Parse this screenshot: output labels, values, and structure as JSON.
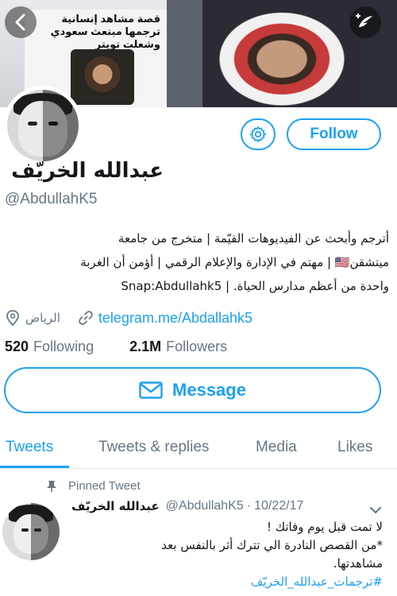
{
  "banner": {
    "headline": "قصة مشاهد إنسانية ترجمها مبتعث سعودي وشعلت تويتر"
  },
  "profile": {
    "name": "عبدالله الخريّف",
    "handle": "@AbdullahK5",
    "follow_label": "Follow",
    "bio_lines": [
      "أترجم وأبحث عن الفيديوهات القيّمة | متخرج من جامعة",
      "ميتشقن🇺🇸 | مهتم في الإدارة والإعلام الرقمي | أؤمن أن الغربة",
      "واحدة من أعظم مدارس الحياة. | Snap:Abdullahk5"
    ],
    "location": "الرياض",
    "link": "telegram.me/Abdallahk5",
    "following_count": "520",
    "following_label": "Following",
    "followers_count": "2.1M",
    "followers_label": "Followers",
    "message_label": "Message"
  },
  "tabs": [
    {
      "label": "Tweets",
      "active": true
    },
    {
      "label": "Tweets & replies",
      "active": false
    },
    {
      "label": "Media",
      "active": false
    },
    {
      "label": "Likes",
      "active": false
    }
  ],
  "tweet": {
    "pinned_label": "Pinned Tweet",
    "name": "عبدالله الخريّف",
    "handle": "@AbdullahK5",
    "separator": "·",
    "date": "10/22/17",
    "lines": [
      "لا تمت قبل يوم وفاتك !",
      "*من القصص النادرة الي تترك أثر بالنفس بعد",
      "مشاهدتها."
    ],
    "hashtag": "#ترجمات_عبدالله_الخريّف"
  },
  "colors": {
    "accent": "#1da1f2",
    "secondary_text": "#657786",
    "primary_text": "#14171a"
  },
  "icons": {
    "back": "chevron-left-icon",
    "compose": "compose-icon",
    "settings": "gear-icon",
    "location": "location-pin-icon",
    "link": "link-icon",
    "message": "envelope-icon",
    "pin": "pin-icon",
    "more": "chevron-down-icon"
  }
}
